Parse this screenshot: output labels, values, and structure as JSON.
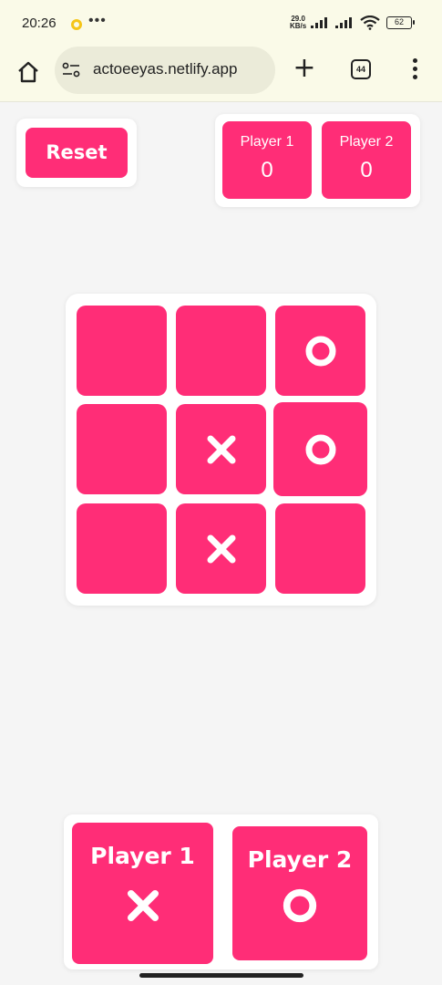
{
  "status_bar": {
    "time": "20:26",
    "net_speed_value": "29.0",
    "net_speed_unit": "KB/s",
    "battery": "62"
  },
  "browser": {
    "url": "actoeeyas.netlify.app",
    "tab_count": "44"
  },
  "game": {
    "reset_label": "Reset",
    "scores": [
      {
        "name": "Player 1",
        "score": "0"
      },
      {
        "name": "Player 2",
        "score": "0"
      }
    ],
    "board": [
      "",
      "",
      "O",
      "",
      "X",
      "O",
      "",
      "X",
      ""
    ],
    "turn_panel": [
      {
        "name": "Player 1",
        "mark": "X"
      },
      {
        "name": "Player 2",
        "mark": "O"
      }
    ],
    "colors": {
      "accent": "#ff2d77",
      "background": "#f5f5f5",
      "card": "#ffffff"
    }
  }
}
